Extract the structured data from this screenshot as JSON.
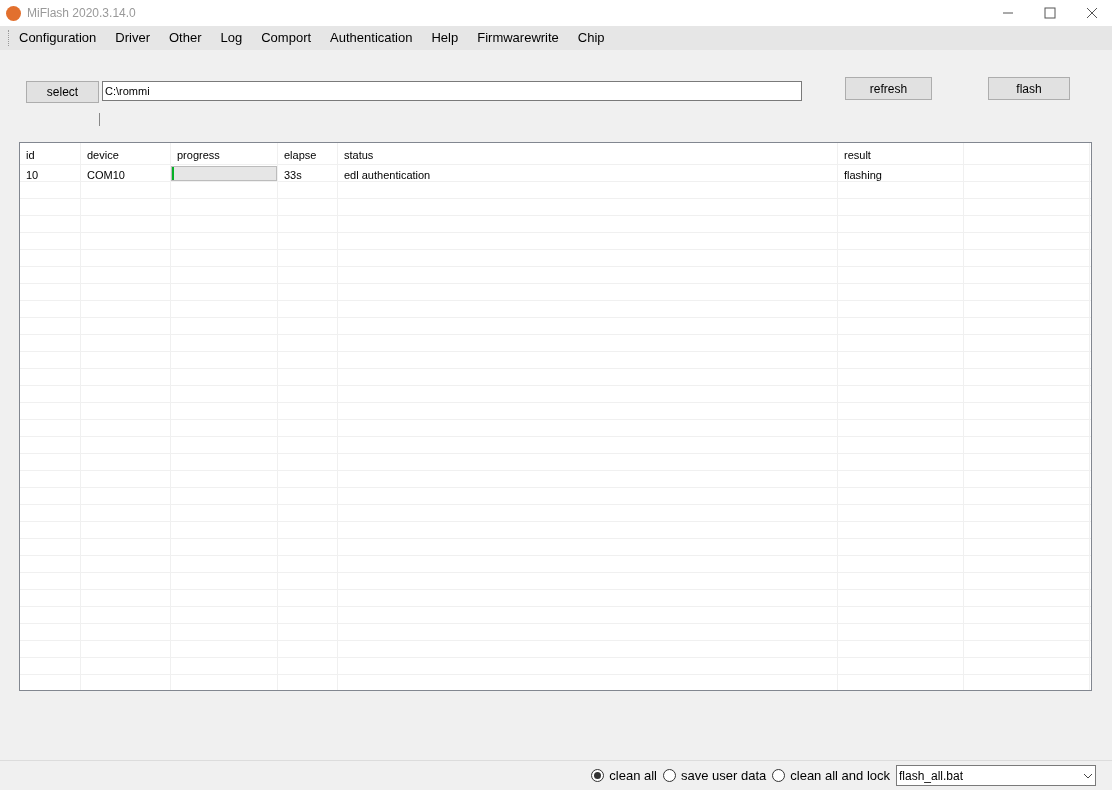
{
  "window": {
    "title": "MiFlash 2020.3.14.0"
  },
  "menu": [
    "Configuration",
    "Driver",
    "Other",
    "Log",
    "Comport",
    "Authentication",
    "Help",
    "Firmwarewrite",
    "Chip"
  ],
  "toolbar": {
    "select_button": "select",
    "path": "C:\\rommi",
    "refresh_button": "refresh",
    "flash_button": "flash"
  },
  "table": {
    "columns": [
      "id",
      "device",
      "progress",
      "elapse",
      "status",
      "result"
    ],
    "rows": [
      {
        "id": "10",
        "device": "COM10",
        "progress": {
          "level": 0.02
        },
        "elapse": "33s",
        "status": "edl authentication",
        "result": "flashing"
      }
    ]
  },
  "options": [
    {
      "label": "clean all",
      "selected": true
    },
    {
      "label": "save user data",
      "selected": false
    },
    {
      "label": "clean all and lock",
      "selected": false
    }
  ],
  "script_select": {
    "value": "flash_all.bat"
  }
}
